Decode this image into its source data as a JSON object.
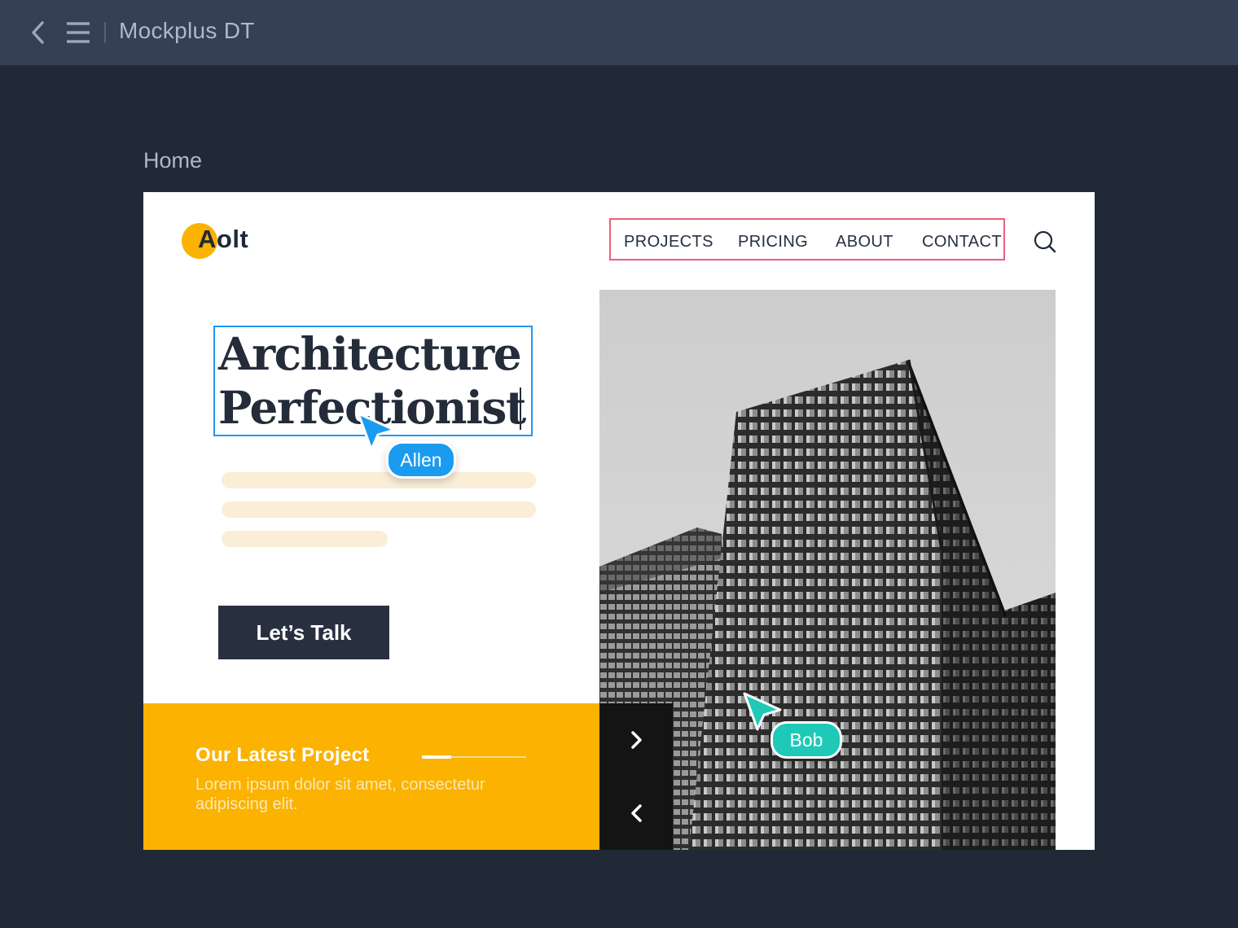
{
  "app": {
    "title": "Mockplus DT",
    "back_icon": "chevron-left-icon",
    "menu_icon": "hamburger-menu-icon"
  },
  "page": {
    "label": "Home"
  },
  "site": {
    "logo": {
      "text": "Aolt",
      "accent_color": "#fbb200"
    },
    "nav": [
      "PROJECTS",
      "PRICING",
      "ABOUT",
      "CONTACT"
    ],
    "search_icon": "search-icon",
    "hero": {
      "headline_line1": "Architecture",
      "headline_line2": "Perfectionist",
      "cta": "Let’s Talk"
    },
    "latest": {
      "title": "Our Latest Project",
      "body": "Lorem ipsum dolor sit amet, consectetur adipiscing elit.",
      "progress": 0.28
    },
    "carousel": {
      "next_icon": "chevron-right-icon",
      "prev_icon": "chevron-left-icon"
    }
  },
  "collaborators": [
    {
      "name": "Allen",
      "color": "#1a9bf0"
    },
    {
      "name": "Bob",
      "color": "#1ec9b7"
    }
  ],
  "colors": {
    "topbar": "#354055",
    "canvas": "#222936",
    "brand_yellow": "#fbb200",
    "selection_blue": "#2196f3",
    "nav_highlight": "#ee5e7d"
  }
}
